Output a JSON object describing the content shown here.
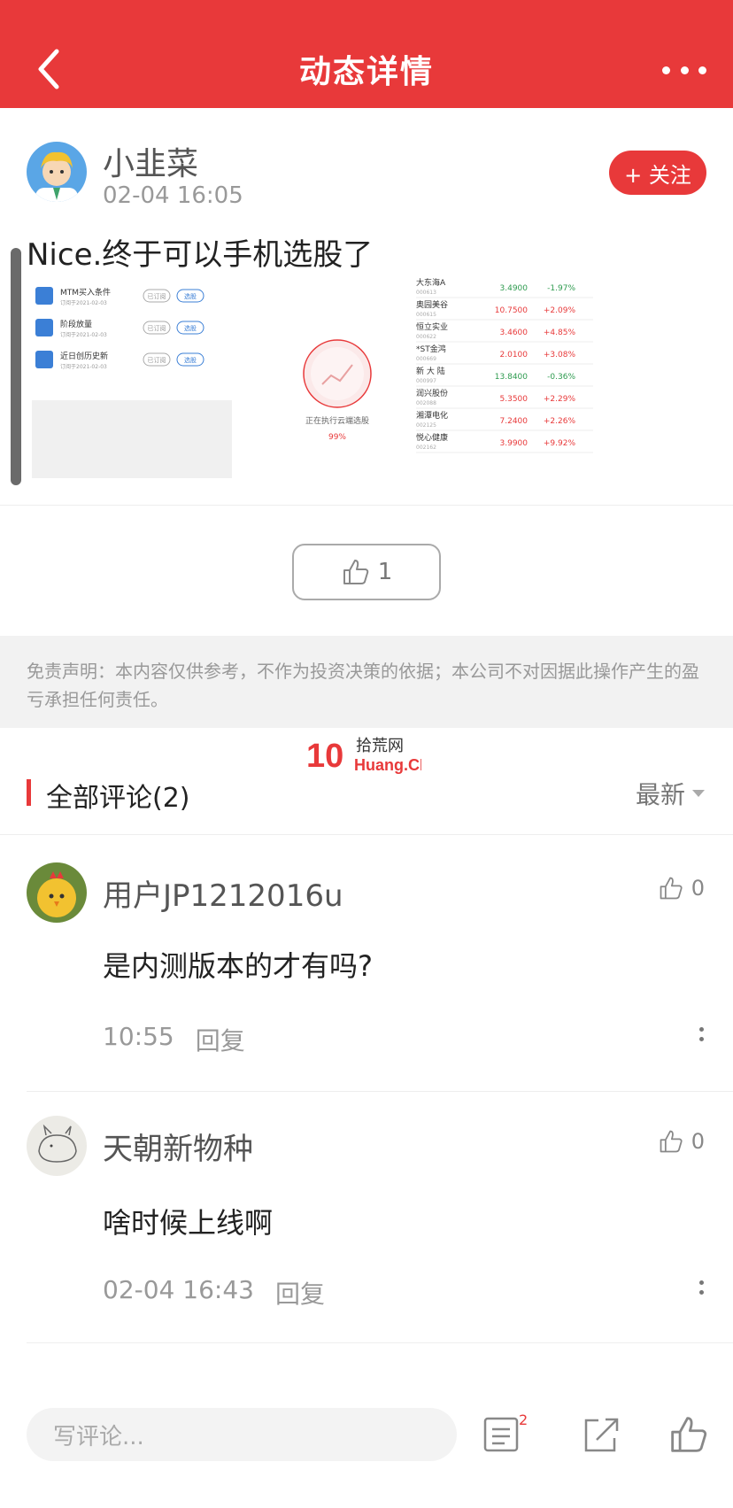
{
  "header": {
    "title": "动态详情"
  },
  "post": {
    "author": "小韭菜",
    "time": "02-04 16:05",
    "follow_label": "+ 关注",
    "text": "Nice.终于可以手机选股了",
    "likes": "1"
  },
  "screenshot": {
    "left_list": [
      {
        "name": "MTM买入条件",
        "sub": "订阅于2021-02-03",
        "btn1": "已订阅",
        "btn2": "选股"
      },
      {
        "name": "阶段放量",
        "sub": "订阅于2021-02-03",
        "btn1": "已订阅",
        "btn2": "选股"
      },
      {
        "name": "近日创历史新",
        "sub": "订阅于2021-02-03",
        "btn1": "已订阅",
        "btn2": "选股"
      }
    ],
    "center_label": "正在执行云端选股",
    "center_progress": "99%",
    "stocks": [
      {
        "name": "大东海A",
        "code": "000613",
        "price": "3.4900",
        "change": "-1.97%",
        "dir": "down"
      },
      {
        "name": "奥园美谷",
        "code": "000615",
        "price": "10.7500",
        "change": "+2.09%",
        "dir": "up"
      },
      {
        "name": "恒立实业",
        "code": "000622",
        "price": "3.4600",
        "change": "+4.85%",
        "dir": "up"
      },
      {
        "name": "*ST金鸿",
        "code": "000669",
        "price": "2.0100",
        "change": "+3.08%",
        "dir": "up"
      },
      {
        "name": "新 大 陆",
        "code": "000997",
        "price": "13.8400",
        "change": "-0.36%",
        "dir": "down"
      },
      {
        "name": "润兴股份",
        "code": "002088",
        "price": "5.3500",
        "change": "+2.29%",
        "dir": "up"
      },
      {
        "name": "湘潭电化",
        "code": "002125",
        "price": "7.2400",
        "change": "+2.26%",
        "dir": "up"
      },
      {
        "name": "悦心健康",
        "code": "002162",
        "price": "3.9900",
        "change": "+9.92%",
        "dir": "up"
      }
    ],
    "colors": {
      "up": "#e8393a",
      "down": "#2e9b4f"
    }
  },
  "disclaimer": "免责声明：本内容仅供参考，不作为投资决策的依据；本公司不对因据此操作产生的盈亏承担任何责任。",
  "watermark": {
    "top": "拾荒网",
    "bottom": "Huang.CN"
  },
  "comments_section": {
    "title": "全部评论(2)",
    "sort": "最新"
  },
  "comments": [
    {
      "user": "用户JP1212016u",
      "text": "是内测版本的才有吗?",
      "time": "10:55",
      "reply": "回复",
      "likes": "0"
    },
    {
      "user": "天朝新物种",
      "text": "啥时候上线啊",
      "time": "02-04 16:43",
      "reply": "回复",
      "likes": "0"
    }
  ],
  "bottom": {
    "placeholder": "写评论...",
    "comment_count": "2"
  },
  "icons": [
    "back-arrow-icon",
    "more-icon",
    "thumb-up-icon",
    "comment-list-icon",
    "share-icon"
  ]
}
